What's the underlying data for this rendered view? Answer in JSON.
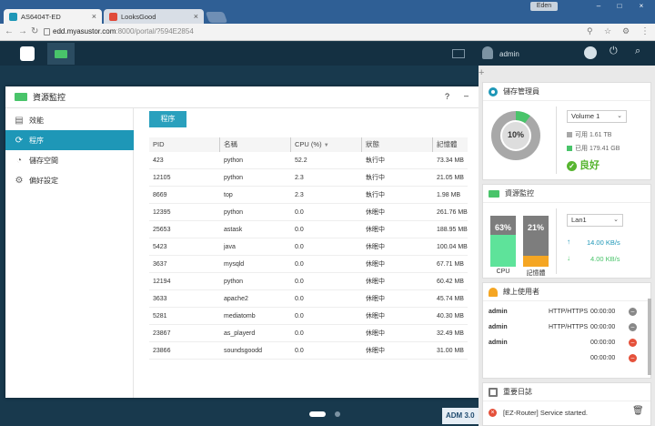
{
  "browser": {
    "tabs": [
      {
        "label": "AS6404T-ED",
        "active": true
      },
      {
        "label": "LooksGood",
        "active": false
      }
    ],
    "user_badge": "Eden",
    "url_host": "edd.myasustor.com",
    "url_rest": ":8000/portal/?594E2854"
  },
  "topbar": {
    "user": "admin"
  },
  "window": {
    "title": "資源監控",
    "help": "?",
    "min": "–",
    "sidebar": [
      {
        "label": "效能",
        "icon": "chart-icon"
      },
      {
        "label": "程序",
        "icon": "refresh-icon"
      },
      {
        "label": "儲存空間",
        "icon": "pie-icon"
      },
      {
        "label": "偏好設定",
        "icon": "gear-icon"
      }
    ],
    "button_label": "程序",
    "columns": [
      "PID",
      "名稱",
      "CPU (%)",
      "狀態",
      "記憶體"
    ],
    "rows": [
      [
        "423",
        "python",
        "52.2",
        "執行中",
        "73.34 MB"
      ],
      [
        "12105",
        "python",
        "2.3",
        "執行中",
        "21.05 MB"
      ],
      [
        "8669",
        "top",
        "2.3",
        "執行中",
        "1.98 MB"
      ],
      [
        "12395",
        "python",
        "0.0",
        "休眠中",
        "261.76 MB"
      ],
      [
        "25653",
        "astask",
        "0.0",
        "休眠中",
        "188.95 MB"
      ],
      [
        "5423",
        "java",
        "0.0",
        "休眠中",
        "100.04 MB"
      ],
      [
        "3637",
        "mysqld",
        "0.0",
        "休眠中",
        "67.71 MB"
      ],
      [
        "12194",
        "python",
        "0.0",
        "休眠中",
        "60.42 MB"
      ],
      [
        "3633",
        "apache2",
        "0.0",
        "休眠中",
        "45.74 MB"
      ],
      [
        "5281",
        "mediatomb",
        "0.0",
        "休眠中",
        "40.30 MB"
      ],
      [
        "23867",
        "as_playerd",
        "0.0",
        "休眠中",
        "32.49 MB"
      ],
      [
        "23866",
        "soundsgoodd",
        "0.0",
        "休眠中",
        "31.00 MB"
      ]
    ]
  },
  "storage": {
    "title": "儲存管理員",
    "percent_label": "10%",
    "used_fraction": 0.1,
    "volume": "Volume 1",
    "free": "可用 1.61 TB",
    "used": "已用 179.41 GB",
    "status": "良好"
  },
  "monitor": {
    "title": "資源監控",
    "cpu_label": "63%",
    "cpu_fraction": 0.63,
    "mem_label": "21%",
    "mem_fraction": 0.21,
    "cpu_caption": "CPU",
    "mem_caption": "記憶體",
    "lan": "Lan1",
    "up": "14.00 KB/s",
    "down": "4.00 KB/s"
  },
  "online": {
    "title": "線上使用者",
    "rows": [
      {
        "user": "admin",
        "proto": "HTTP/HTTPS",
        "time": "00:00:00"
      },
      {
        "user": "admin",
        "proto": "HTTP/HTTPS",
        "time": "00:00:00"
      },
      {
        "user": "admin",
        "proto": "",
        "time": "00:00:00"
      },
      {
        "user": "",
        "proto": "",
        "time": "00:00:00"
      }
    ]
  },
  "log": {
    "title": "重要日誌",
    "entry": "[EZ-Router] Service started."
  },
  "adm_version": "ADM 3.0",
  "colors": {
    "accent": "#1e97b7",
    "green": "#49c46a",
    "orange": "#f5a623",
    "status_good": "#57b530"
  }
}
